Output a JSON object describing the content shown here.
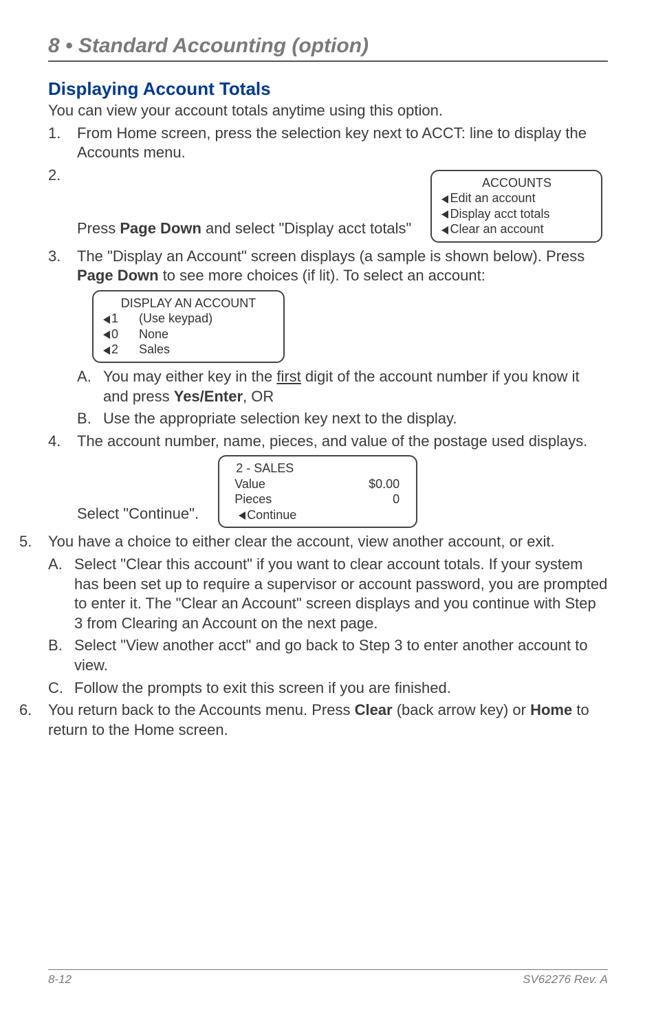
{
  "chapter": "8 • Standard Accounting (option)",
  "heading": "Displaying Account Totals",
  "intro": "You can view your account totals anytime using this option.",
  "steps": {
    "s1": "From Home screen, press the selection key next to ACCT: line to display the Accounts menu.",
    "s2_a": "Press ",
    "s2_b": "Page Down",
    "s2_c": " and select \"Display acct totals\"",
    "screen1": {
      "title": "ACCOUNTS",
      "r1": "Edit an account",
      "r2": "Display acct totals",
      "r3": "Clear an account"
    },
    "s3_a": "The \"Display an Account\" screen displays (a sample is shown below). Press ",
    "s3_b": "Page Down",
    "s3_c": " to see more choices (if lit). To select an account:",
    "screen2": {
      "title": "DISPLAY AN ACCOUNT",
      "r1_num": "1",
      "r1_txt": "(Use keypad)",
      "r2_num": "0",
      "r2_txt": "None",
      "r3_num": "2",
      "r3_txt": "Sales"
    },
    "s3A_a": "You may either key in the ",
    "s3A_first": "first",
    "s3A_b": " digit of the account number if you know it and press ",
    "s3A_c": "Yes/Enter",
    "s3A_d": ",  OR",
    "s3B": "Use the appropriate selection key next to the display.",
    "s4": "The account number, name, pieces, and value of the postage used displays. Select \"Continue\".",
    "screen3": {
      "title": "2    - SALES",
      "r1l": "Value",
      "r1r": "$0.00",
      "r2l": "Pieces",
      "r2r": "0",
      "r3": "Continue"
    },
    "s5": "You have a choice to either clear the account, view another account, or exit.",
    "s5A": "Select \"Clear this account\" if you want to clear account totals. If your system has been set up to require a supervisor or account password, you are prompted to enter it. The \"Clear an Account\" screen displays and you continue with Step 3 from Clearing an Account on the next page.",
    "s5B": "Select \"View another acct\" and go back to Step 3 to enter another account to view.",
    "s5C": "Follow the prompts to exit this screen if you are finished.",
    "s6_a": "You return back to the Accounts menu. Press ",
    "s6_b": "Clear",
    "s6_c": " (back arrow key) or ",
    "s6_d": "Home",
    "s6_e": " to return to the Home screen."
  },
  "footer": {
    "left": "8-12",
    "right": "SV62276 Rev. A"
  }
}
